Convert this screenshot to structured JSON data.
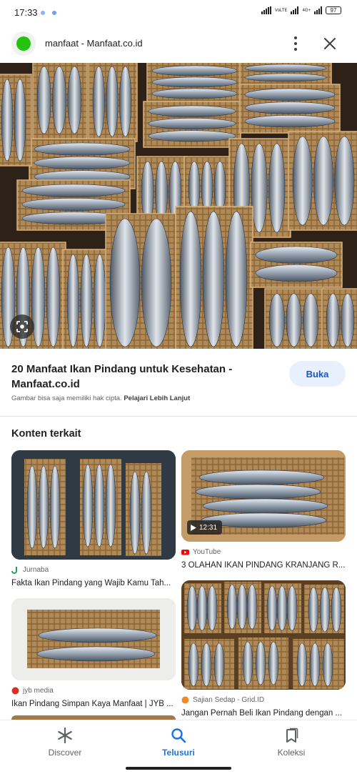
{
  "status_bar": {
    "time": "17:33",
    "network_badge_1": "VoLTE",
    "network_badge_2": "4G+",
    "battery": "97"
  },
  "header": {
    "title": "manfaat - Manfaat.co.id",
    "favicon_color": "#22c40f"
  },
  "result": {
    "title": "20 Manfaat Ikan Pindang untuk Kesehatan - Manfaat.co.id",
    "open_label": "Buka",
    "copyright_text": "Gambar bisa saja memiliki hak cipta.",
    "learn_more": "Pelajari Lebih Lanjut"
  },
  "related": {
    "title": "Konten terkait",
    "items": [
      {
        "source": "Jurnaba",
        "caption": "Fakta Ikan Pindang yang Wajib Kamu Tah...",
        "source_icon": "j-logo-icon"
      },
      {
        "source": "YouTube",
        "caption": "3 OLAHAN IKAN PINDANG KRANJANG R...",
        "duration": "12:31",
        "source_icon": "youtube-icon"
      },
      {
        "source": "jyb media",
        "caption": "Ikan Pindang Simpan Kaya Manfaat | JYB ...",
        "source_icon": "jyb-icon"
      },
      {
        "source": "Sajian Sedap - Grid.ID",
        "caption": "Jangan Pernah Beli Ikan Pindang dengan ...",
        "source_icon": "sajian-sedap-icon"
      }
    ]
  },
  "bottom_nav": {
    "items": [
      {
        "label": "Discover",
        "icon": "asterisk-icon"
      },
      {
        "label": "Telusuri",
        "icon": "search-icon"
      },
      {
        "label": "Koleksi",
        "icon": "collections-icon"
      }
    ],
    "active_color": "#1a73e8"
  }
}
